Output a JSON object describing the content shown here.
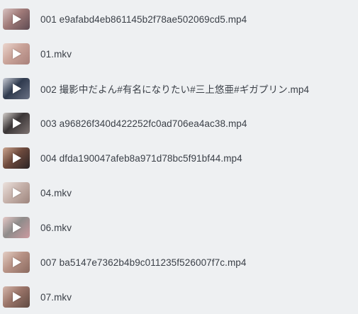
{
  "files": [
    {
      "name": "001 e9afabd4eb861145b2f78ae502069cd5.mp4",
      "thumb_colors": [
        "#a07a78",
        "#d9c3c2",
        "#5d4a52"
      ]
    },
    {
      "name": "01.mkv",
      "thumb_colors": [
        "#caa49a",
        "#ecd7cf",
        "#a8807a"
      ]
    },
    {
      "name": "002 撮影中だよん#有名になりたい#三上悠亜#ギガプリン.mp4",
      "thumb_colors": [
        "#2f3a4e",
        "#c9cdd6",
        "#6a7184"
      ]
    },
    {
      "name": "003 a96826f340d422252fc0ad706ea4ac38.mp4",
      "thumb_colors": [
        "#3a3536",
        "#d4cfcc",
        "#7e7472"
      ]
    },
    {
      "name": "004 dfda190047afeb8a971d78bc5f91bf44.mp4",
      "thumb_colors": [
        "#6e4a3d",
        "#cba58f",
        "#2a2324"
      ]
    },
    {
      "name": "04.mkv",
      "thumb_colors": [
        "#c7b3ac",
        "#ece2de",
        "#9d857d"
      ]
    },
    {
      "name": "06.mkv",
      "thumb_colors": [
        "#8f8c8b",
        "#e6c9c7",
        "#cc9aa0"
      ]
    },
    {
      "name": "007 ba5147e7362b4b9c011235f526007f7c.mp4",
      "thumb_colors": [
        "#b89386",
        "#e4cfc6",
        "#8a6a60"
      ]
    },
    {
      "name": "07.mkv",
      "thumb_colors": [
        "#9a7468",
        "#d6b8ad",
        "#5f4942"
      ]
    }
  ]
}
